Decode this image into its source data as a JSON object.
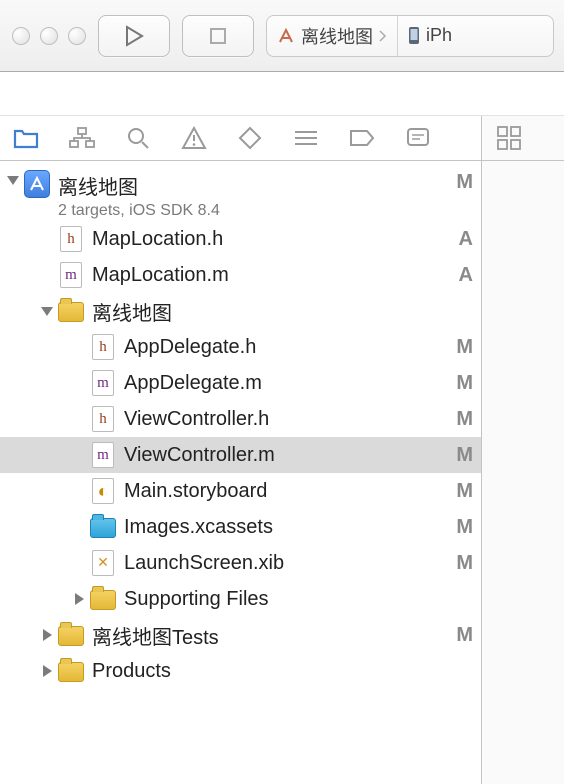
{
  "toolbar": {
    "scheme_label": "离线地图",
    "device_label": "iPh"
  },
  "project": {
    "name": "离线地图",
    "subtitle": "2 targets, iOS SDK 8.4",
    "status": "M"
  },
  "tree": [
    {
      "name": "MapLocation.h",
      "type": "h",
      "level": 1,
      "status": "A"
    },
    {
      "name": "MapLocation.m",
      "type": "m",
      "level": 1,
      "status": "A"
    },
    {
      "name": "离线地图",
      "type": "folder",
      "level": 1,
      "status": "",
      "disclosure": "open"
    },
    {
      "name": "AppDelegate.h",
      "type": "h",
      "level": 2,
      "status": "M"
    },
    {
      "name": "AppDelegate.m",
      "type": "m",
      "level": 2,
      "status": "M"
    },
    {
      "name": "ViewController.h",
      "type": "h",
      "level": 2,
      "status": "M"
    },
    {
      "name": "ViewController.m",
      "type": "m",
      "level": 2,
      "status": "M",
      "selected": true
    },
    {
      "name": "Main.storyboard",
      "type": "sb",
      "level": 2,
      "status": "M"
    },
    {
      "name": "Images.xcassets",
      "type": "assets",
      "level": 2,
      "status": "M"
    },
    {
      "name": "LaunchScreen.xib",
      "type": "xib",
      "level": 2,
      "status": "M"
    },
    {
      "name": "Supporting Files",
      "type": "folder",
      "level": 2,
      "status": "",
      "disclosure": "closed"
    },
    {
      "name": "离线地图Tests",
      "type": "folder",
      "level": 1,
      "status": "M",
      "disclosure": "closed"
    },
    {
      "name": "Products",
      "type": "folder",
      "level": 1,
      "status": "",
      "disclosure": "closed"
    }
  ]
}
